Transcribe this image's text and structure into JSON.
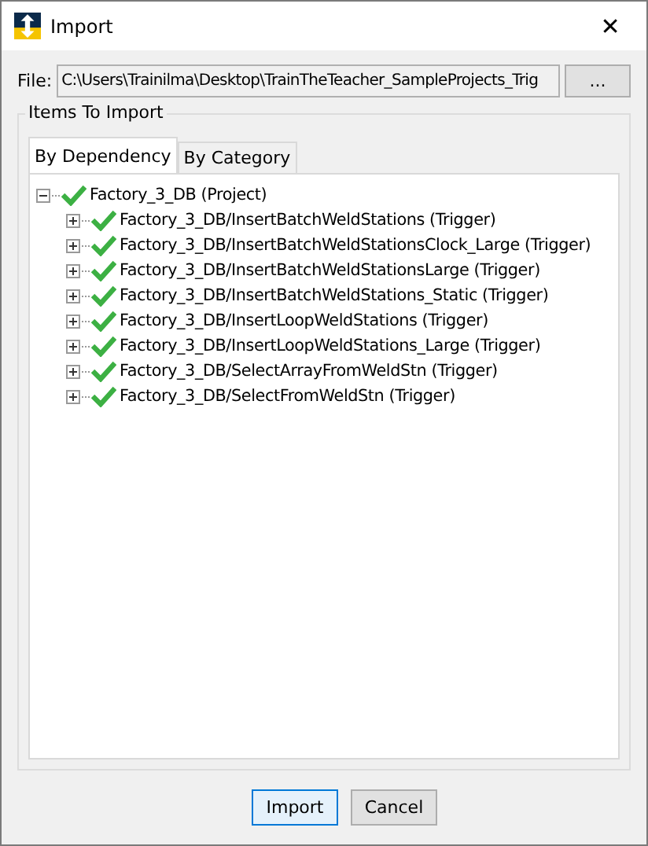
{
  "window": {
    "title": "Import",
    "close": "✕"
  },
  "file": {
    "label": "File:",
    "value": "C:\\Users\\Trainilma\\Desktop\\TrainTheTeacher_SampleProjects_Trig",
    "browse": "..."
  },
  "group": {
    "title": "Items To Import"
  },
  "tabs": [
    {
      "label": "By Dependency",
      "selected": true
    },
    {
      "label": "By Category",
      "selected": false
    }
  ],
  "tree": [
    {
      "label": "Factory_3_DB (Project)",
      "checked": true,
      "expanded": true,
      "children": [
        {
          "label": "Factory_3_DB/InsertBatchWeldStations (Trigger)",
          "checked": true,
          "expanded": false
        },
        {
          "label": "Factory_3_DB/InsertBatchWeldStationsClock_Large (Trigger)",
          "checked": true,
          "expanded": false
        },
        {
          "label": "Factory_3_DB/InsertBatchWeldStationsLarge (Trigger)",
          "checked": true,
          "expanded": false
        },
        {
          "label": "Factory_3_DB/InsertBatchWeldStations_Static (Trigger)",
          "checked": true,
          "expanded": false
        },
        {
          "label": "Factory_3_DB/InsertLoopWeldStations (Trigger)",
          "checked": true,
          "expanded": false
        },
        {
          "label": "Factory_3_DB/InsertLoopWeldStations_Large (Trigger)",
          "checked": true,
          "expanded": false
        },
        {
          "label": "Factory_3_DB/SelectArrayFromWeldStn (Trigger)",
          "checked": true,
          "expanded": false
        },
        {
          "label": "Factory_3_DB/SelectFromWeldStn (Trigger)",
          "checked": true,
          "expanded": false
        }
      ]
    }
  ],
  "buttons": [
    {
      "label": "Import",
      "kind": "default"
    },
    {
      "label": "Cancel",
      "kind": "normal"
    }
  ]
}
